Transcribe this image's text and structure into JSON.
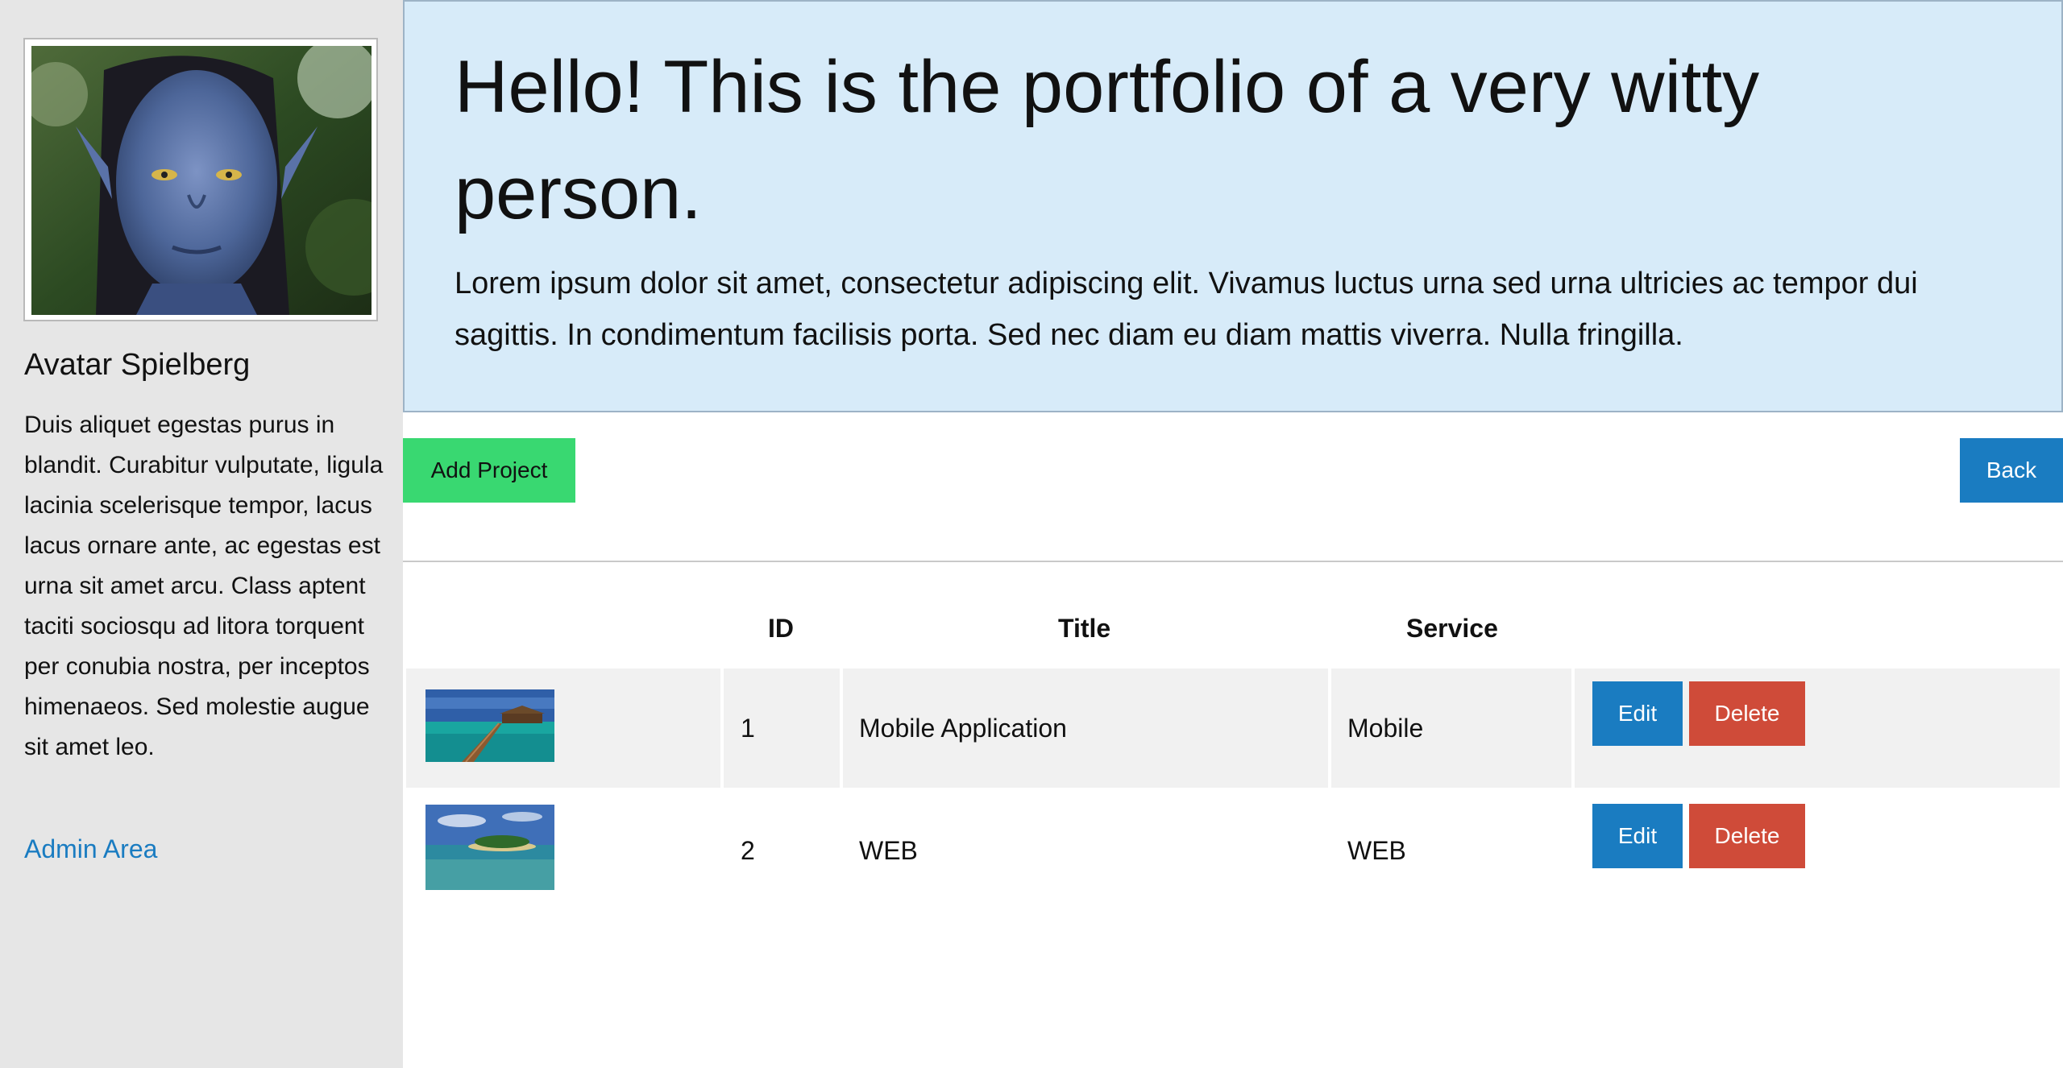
{
  "sidebar": {
    "avatar_alt": "Avatar profile photo",
    "name": "Avatar Spielberg",
    "bio": "Duis aliquet egestas purus in blandit. Curabitur vulputate, ligula lacinia scelerisque tempor, lacus lacus ornare ante, ac egestas est urna sit amet arcu. Class aptent taciti sociosqu ad litora torquent per conubia nostra, per inceptos himenaeos. Sed molestie augue sit amet leo.",
    "admin_link": "Admin Area"
  },
  "hero": {
    "title": "Hello! This is the portfolio of a very witty person.",
    "text": "Lorem ipsum dolor sit amet, consectetur adipiscing elit. Vivamus luctus urna sed urna ultricies ac tempor dui sagittis. In condimentum facilisis porta. Sed nec diam eu diam mattis viverra. Nulla fringilla."
  },
  "toolbar": {
    "add_label": "Add Project",
    "back_label": "Back"
  },
  "table": {
    "headers": {
      "id": "ID",
      "title": "Title",
      "service": "Service"
    },
    "rows": [
      {
        "id": "1",
        "title": "Mobile Application",
        "service": "Mobile",
        "edit": "Edit",
        "delete": "Delete"
      },
      {
        "id": "2",
        "title": "WEB",
        "service": "WEB",
        "edit": "Edit",
        "delete": "Delete"
      }
    ]
  },
  "colors": {
    "sidebar_bg": "#e6e6e6",
    "hero_bg": "#d7ebf9",
    "primary": "#1a7cc1",
    "success": "#39d871",
    "danger": "#cf4b39",
    "row_stripe": "#f1f1f1"
  }
}
